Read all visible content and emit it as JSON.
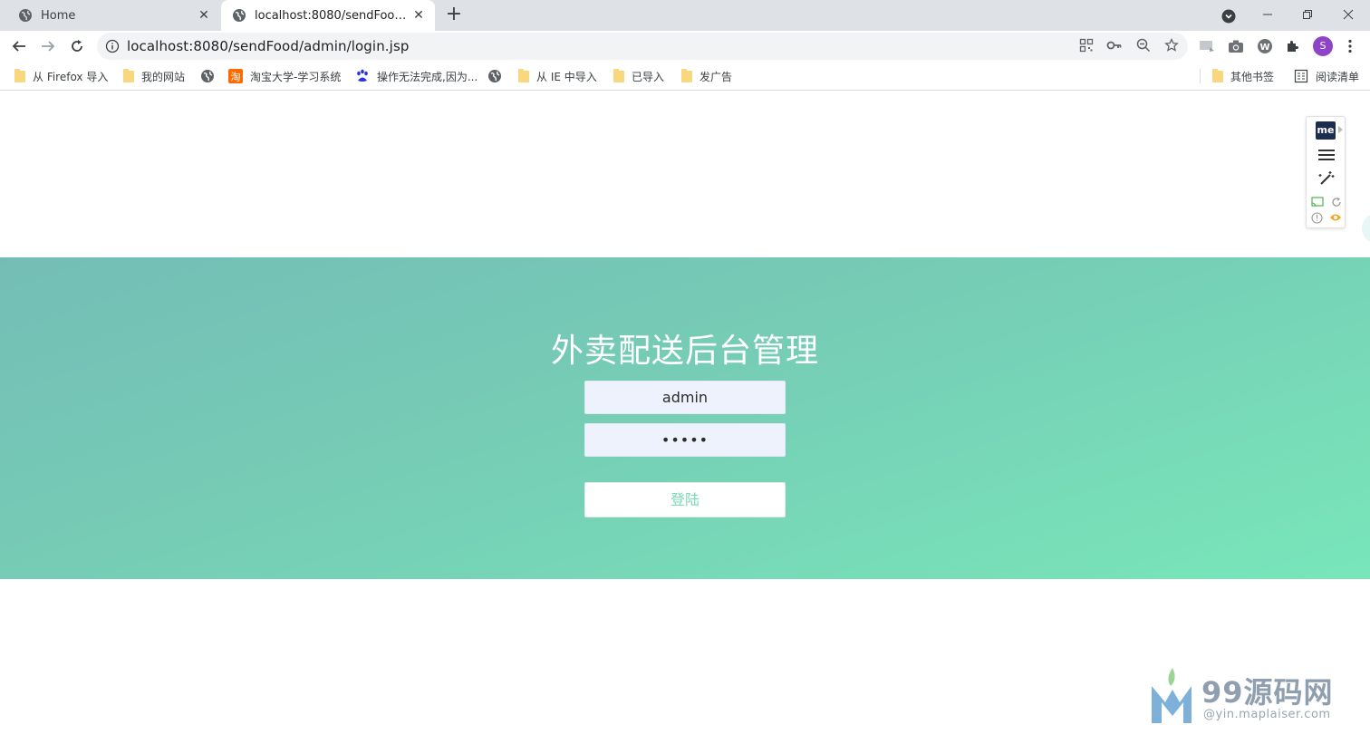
{
  "browser": {
    "tabs": [
      {
        "title": "Home",
        "active": false
      },
      {
        "title": "localhost:8080/sendFood/admin/login.jsp",
        "active": true
      }
    ],
    "address": {
      "host": "localhost",
      "rest": ":8080/sendFood/admin/login.jsp"
    },
    "avatar_letter": "S",
    "bookmarks": [
      {
        "label": "从 Firefox 导入",
        "icon": "folder-icon"
      },
      {
        "label": "我的网站",
        "icon": "folder-icon"
      },
      {
        "label": "",
        "icon": "globe-icon"
      },
      {
        "label": "淘宝大学-学习系统",
        "icon": "taobao-icon"
      },
      {
        "label": "操作无法完成,因为...",
        "icon": "baidu-paw-icon"
      },
      {
        "label": "",
        "icon": "globe-icon"
      },
      {
        "label": "从 IE 中导入",
        "icon": "folder-icon"
      },
      {
        "label": "已导入",
        "icon": "folder-icon"
      },
      {
        "label": "发广告",
        "icon": "folder-icon"
      }
    ],
    "other_bookmarks": "其他书签",
    "reading_list": "阅读清单"
  },
  "extension_panel": {
    "logo_text": "me"
  },
  "login": {
    "title": "外卖配送后台管理",
    "username_value": "admin",
    "password_value": "•••••",
    "submit_label": "登陆"
  },
  "watermark": {
    "brand": "99源码网",
    "sub": "@yin.maplaiser.com"
  },
  "colors": {
    "banner_start": "#74bdb6",
    "banner_end": "#78e6ba",
    "input_bg": "#eef2fd",
    "button_text": "#7adab4"
  }
}
